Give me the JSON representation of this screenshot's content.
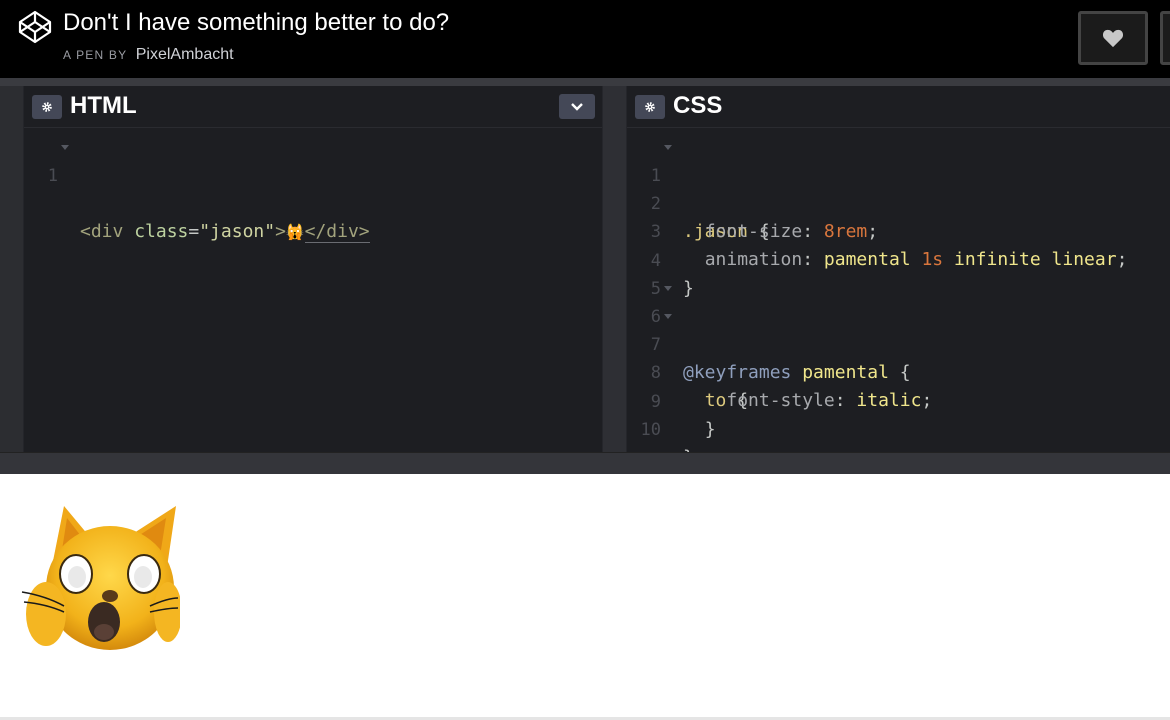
{
  "header": {
    "title": "Don't I have something better to do?",
    "byline_prefix": "A PEN BY",
    "author": "PixelAmbacht",
    "icons": {
      "logo": "codepen-logo-icon",
      "heart": "heart-icon"
    }
  },
  "editors": {
    "html": {
      "title": "HTML",
      "icons": {
        "settings": "gear-icon",
        "collapse": "chevron-down-icon"
      },
      "lines": [
        {
          "num": "1",
          "open": "<div ",
          "attr": "class",
          "eq": "=",
          "str": "\"jason\"",
          "gt": ">",
          "emoji": "🙀",
          "close": "</div>"
        }
      ]
    },
    "css": {
      "title": "CSS",
      "icons": {
        "settings": "gear-icon"
      },
      "line_numbers": [
        "1",
        "2",
        "3",
        "4",
        "5",
        "6",
        "7",
        "8",
        "9",
        "10"
      ],
      "code": {
        "l1_sel": ".jason",
        "l1_brace": " {",
        "l2_prop": "font-size",
        "l2_colon": ": ",
        "l2_num": "8rem",
        "l2_semi": ";",
        "l3_prop": "animation",
        "l3_colon": ": ",
        "l3_name": "pamental",
        "l3_num": "1s",
        "l3_rest": "infinite linear",
        "l3_semi": ";",
        "l4_brace": "}",
        "l6_at": "@keyframes",
        "l6_name": "pamental",
        "l6_brace": " {",
        "l7_key": "to",
        "l7_brace": " {",
        "l8_prop": "font-style",
        "l8_colon": ": ",
        "l8_val": "italic",
        "l8_semi": ";",
        "l9_brace": "}",
        "l10_brace": "}"
      }
    }
  },
  "preview": {
    "emoji_name": "weary-cat-face",
    "emoji": "🙀"
  },
  "colors": {
    "header_bg": "#000000",
    "editor_bg": "#1d1e22",
    "button_bg": "#444857",
    "number_orange": "#d9763d",
    "value_yellow": "#f0e68c"
  }
}
